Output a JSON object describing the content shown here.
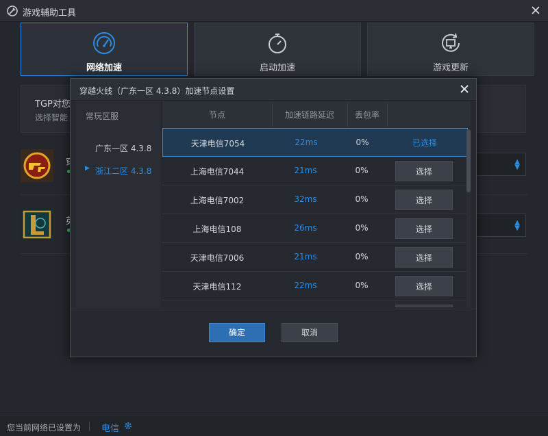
{
  "window": {
    "title": "游戏辅助工具",
    "logo_icon": "tools-icon",
    "close_icon": "close-icon"
  },
  "tabs": [
    {
      "label": "网络加速",
      "icon": "speedometer-icon",
      "active": true
    },
    {
      "label": "启动加速",
      "icon": "stopwatch-icon",
      "active": false
    },
    {
      "label": "游戏更新",
      "icon": "monitor-refresh-icon",
      "active": false
    }
  ],
  "info": {
    "line1": "TGP对您",
    "line2": "选择智能"
  },
  "games": [
    {
      "name": "穿",
      "icon": "crossfire-logo-icon"
    },
    {
      "name": "英",
      "icon": "lol-logo-icon"
    }
  ],
  "footer": {
    "text": "您当前网络已设置为",
    "network": "电信",
    "gear_icon": "gear-icon"
  },
  "modal": {
    "title": "穿越火线（广东一区 4.3.8）加速节点设置",
    "regions_header": "常玩区服",
    "regions": [
      {
        "label": "广东一区 4.3.8",
        "active": false
      },
      {
        "label": "浙江二区 4.3.8",
        "active": true
      }
    ],
    "columns": {
      "node": "节点",
      "latency": "加速链路延迟",
      "loss": "丢包率"
    },
    "rows": [
      {
        "node": "天津电信7054",
        "latency": "22ms",
        "loss": "0%",
        "action": "已选择",
        "selected": true
      },
      {
        "node": "上海电信7044",
        "latency": "21ms",
        "loss": "0%",
        "action": "选择",
        "selected": false
      },
      {
        "node": "上海电信7002",
        "latency": "32ms",
        "loss": "0%",
        "action": "选择",
        "selected": false
      },
      {
        "node": "上海电信108",
        "latency": "26ms",
        "loss": "0%",
        "action": "选择",
        "selected": false
      },
      {
        "node": "天津电信7006",
        "latency": "21ms",
        "loss": "0%",
        "action": "选择",
        "selected": false
      },
      {
        "node": "天津电信112",
        "latency": "22ms",
        "loss": "0%",
        "action": "选择",
        "selected": false
      }
    ],
    "ok_label": "确定",
    "cancel_label": "取消"
  },
  "colors": {
    "accent": "#2d8ce0",
    "online": "#3bbf52"
  }
}
